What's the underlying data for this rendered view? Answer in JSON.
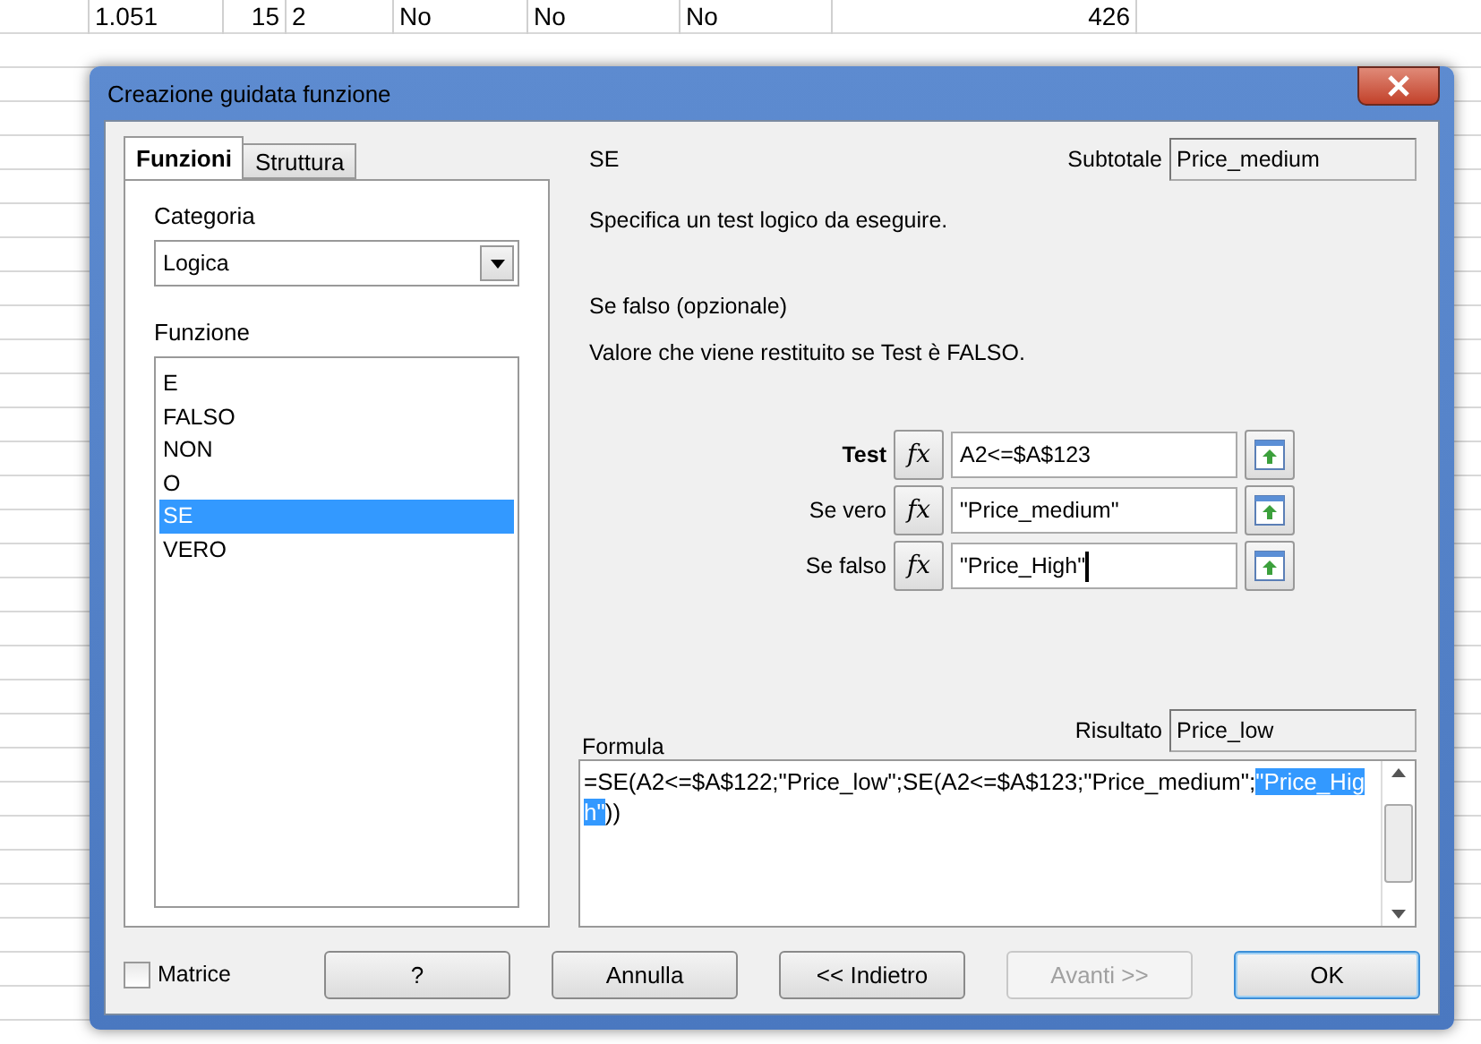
{
  "sheet": {
    "rows": [
      {
        "cells": [
          "1.051",
          "15",
          "2",
          "No",
          "No",
          "No",
          "426"
        ]
      }
    ]
  },
  "dialog": {
    "title": "Creazione guidata funzione",
    "tabs": [
      {
        "label": "Funzioni",
        "selected": true
      },
      {
        "label": "Struttura",
        "selected": false
      }
    ],
    "category": {
      "label": "Categoria",
      "value": "Logica"
    },
    "function_list": {
      "label": "Funzione",
      "items": [
        {
          "label": "E",
          "selected": false
        },
        {
          "label": "FALSO",
          "selected": false
        },
        {
          "label": "NON",
          "selected": false
        },
        {
          "label": "O",
          "selected": false
        },
        {
          "label": "SE",
          "selected": true
        },
        {
          "label": "VERO",
          "selected": false
        }
      ]
    },
    "function_name": "SE",
    "subtotal": {
      "label": "Subtotale",
      "value": "Price_medium"
    },
    "description": "Specifica un test logico da eseguire.",
    "argument_title": "Se falso (opzionale)",
    "argument_description": "Valore che viene restituito se Test è FALSO.",
    "arguments": [
      {
        "label": "Test",
        "value": "A2<=$A$123",
        "bold": true,
        "fx": "fx"
      },
      {
        "label": "Se vero",
        "value": "\"Price_medium\"",
        "bold": false,
        "fx": "fx"
      },
      {
        "label": "Se falso",
        "value": "\"Price_High\"",
        "bold": false,
        "fx": "fx"
      }
    ],
    "formula": {
      "label": "Formula",
      "before": "=SE(A2<=$A$122;\"Price_low\";SE(A2<=$A$123;\"Price_medium\";",
      "selected": "\"Price_High\"",
      "after": "))"
    },
    "result": {
      "label": "Risultato",
      "value": "Price_low"
    },
    "matrix": {
      "label": "Matrice",
      "checked": false
    },
    "buttons": [
      {
        "label": "?",
        "disabled": false,
        "default": false
      },
      {
        "label": "Annulla",
        "disabled": false,
        "default": false
      },
      {
        "label": "<< Indietro",
        "disabled": false,
        "default": false
      },
      {
        "label": "Avanti >>",
        "disabled": true,
        "default": false
      },
      {
        "label": "OK",
        "disabled": false,
        "default": true
      }
    ]
  }
}
